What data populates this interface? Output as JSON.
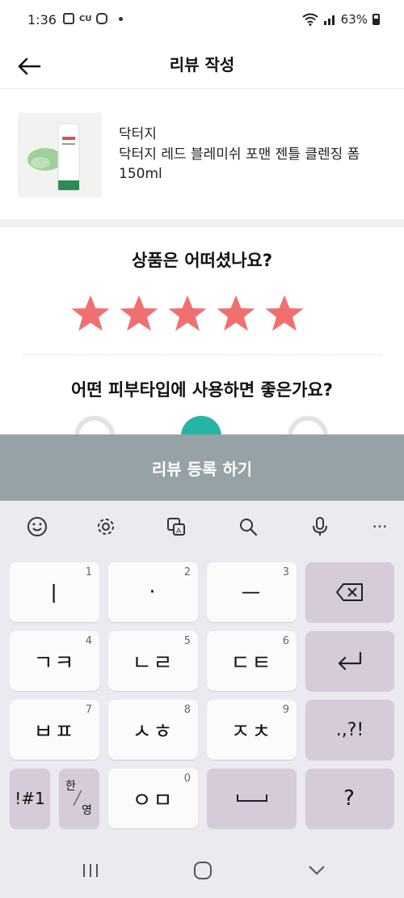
{
  "status_bar": {
    "time": "1:36",
    "carrier_badge": "CU",
    "battery": "63%"
  },
  "header": {
    "title": "리뷰 작성",
    "back_icon": "arrow-left-icon"
  },
  "product": {
    "brand": "닥터지",
    "name": "닥터지 레드 블레미쉬 포맨 젠틀 클렌징 폼 150ml"
  },
  "rating": {
    "question": "상품은 어떠셨나요?",
    "stars_selected": 5,
    "stars_total": 5,
    "star_color": "#f07070"
  },
  "skin_type": {
    "question": "어떤 피부타입에 사용하면 좋은가요?",
    "selected_color": "#26b5a5"
  },
  "submit": {
    "label": "리뷰 등록 하기",
    "bg_color": "#97a2a6"
  },
  "keyboard": {
    "toolbar": [
      "emoji-icon",
      "settings-icon",
      "translate-icon",
      "search-icon",
      "mic-icon",
      "more-icon"
    ],
    "more_label": "···",
    "rows": [
      [
        {
          "label": "ㅣ",
          "hint": "1"
        },
        {
          "label": "·",
          "hint": "2"
        },
        {
          "label": "ㅡ",
          "hint": "3"
        }
      ],
      [
        {
          "label": "ㄱㅋ",
          "hint": "4"
        },
        {
          "label": "ㄴㄹ",
          "hint": "5"
        },
        {
          "label": "ㄷㅌ",
          "hint": "6"
        }
      ],
      [
        {
          "label": "ㅂㅍ",
          "hint": "7"
        },
        {
          "label": "ㅅㅎ",
          "hint": "8"
        },
        {
          "label": "ㅈㅊ",
          "hint": "9"
        }
      ]
    ],
    "punct_key": ".,?!",
    "symbols_key": "!#1",
    "lang_top": "한",
    "lang_bottom": "영",
    "zero_key": {
      "label": "ㅇㅁ",
      "hint": "0"
    },
    "question_key": "?"
  },
  "nav_bar": [
    "recents-icon",
    "home-icon",
    "back-icon"
  ]
}
